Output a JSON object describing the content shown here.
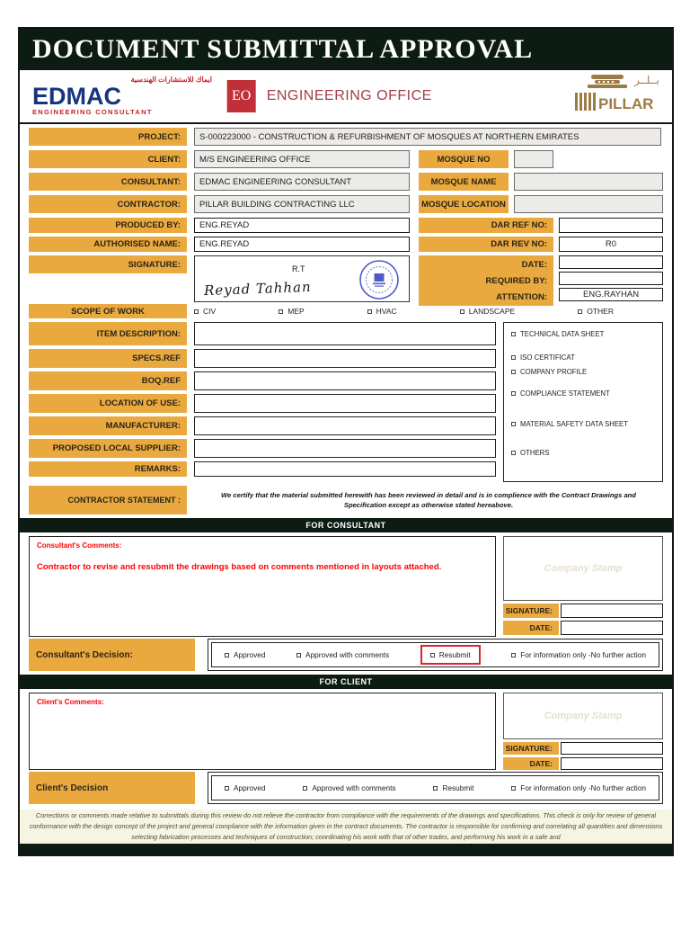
{
  "title": "DOCUMENT SUBMITTAL APPROVAL",
  "logos": {
    "edmac": {
      "arabic": "ايماك للاستشارات الهندسية",
      "name": "EDMAC",
      "subtitle": "ENGINEERING CONSULTANT"
    },
    "eo": {
      "abbr": "EO",
      "name": "ENGINEERING OFFICE"
    },
    "pillar": {
      "arabic": "بــلــر",
      "name": "PILLAR"
    }
  },
  "form": {
    "rows": {
      "project": {
        "label": "PROJECT:",
        "value": "S-000223000 - CONSTRUCTION & REFURBISHMENT OF MOSQUES AT NORTHERN EMIRATES"
      },
      "client": {
        "label": "CLIENT:",
        "value": "M/S ENGINEERING OFFICE"
      },
      "consultant": {
        "label": "CONSULTANT:",
        "value": "EDMAC ENGINEERING CONSULTANT"
      },
      "contractor": {
        "label": "CONTRACTOR:",
        "value": "PILLAR BUILDING CONTRACTING LLC"
      },
      "produced_by": {
        "label": "PRODUCED BY:",
        "value": "ENG.REYAD"
      },
      "authorised_name": {
        "label": "AUTHORISED NAME:",
        "value": "ENG.REYAD"
      },
      "signature": {
        "label": "SIGNATURE:",
        "script_name": "Reyad Tahhan",
        "initials": "R.T"
      },
      "mosque_no": {
        "label": "MOSQUE NO",
        "value": ""
      },
      "mosque_name": {
        "label": "MOSQUE NAME",
        "value": ""
      },
      "mosque_location": {
        "label": "MOSQUE LOCATION",
        "value": ""
      },
      "dar_ref_no": {
        "label": "DAR REF NO:",
        "value": ""
      },
      "dar_rev_no": {
        "label": "DAR REV NO:",
        "value": "R0"
      },
      "date": {
        "label": "DATE:",
        "value": ""
      },
      "required_by": {
        "label": "REQUIRED BY:",
        "value": ""
      },
      "attention": {
        "label": "ATTENTION:",
        "value": "ENG.RAYHAN"
      }
    },
    "scope_of_work": {
      "label": "SCOPE OF WORK",
      "options": [
        "CIV",
        "MEP",
        "HVAC",
        "LANDSCAPE",
        "OTHER"
      ]
    },
    "item_description_label": "ITEM DESCRIPTION:",
    "specs_ref_label": "SPECS.REF",
    "boq_ref_label": "BOQ.REF",
    "location_of_use_label": "LOCATION OF USE:",
    "manufacturer_label": "MANUFACTURER:",
    "proposed_local_supplier_label": "PROPOSED LOCAL SUPPLIER:",
    "remarks_label": "REMARKS:",
    "contractor_statement": {
      "label": "CONTRACTOR STATEMENT :",
      "text": "We certify that the material submitted herewith has been reviewed in detail and is in complience with the  Contract Drawings and Specification except as otherwise stated hereabove."
    },
    "attachments": [
      "TECHNICAL DATA SHEET",
      "ISO CERTIFICAT",
      "COMPANY PROFILE",
      "COMPLIANCE STATEMENT",
      "MATERIAL SAFETY DATA SHEET",
      "OTHERS"
    ]
  },
  "consultant_section": {
    "bar_title": "FOR CONSULTANT",
    "comments_label": "Consultant's Comments:",
    "comments_text": "Contractor to revise and resubmit the drawings based on comments mentioned in layouts attached.",
    "stamp_text": "Company Stamp",
    "signature_label": "SIGNATURE:",
    "date_label": "DATE:",
    "decision_label": "Consultant's Decision:",
    "options": [
      "Approved",
      "Approved with comments",
      "Resubmit",
      "For information only -No further action"
    ],
    "highlighted_option": "Resubmit"
  },
  "client_section": {
    "bar_title": "FOR CLIENT",
    "comments_label": "Client's Comments:",
    "comments_text": "",
    "stamp_text": "Company Stamp",
    "signature_label": "SIGNATURE:",
    "date_label": "DATE:",
    "decision_label": "Client's Decision",
    "options": [
      "Approved",
      "Approved with comments",
      "Resubmit",
      "For information only -No further action"
    ]
  },
  "footer_text": "Corrections or comments made relative to submittals during this review do not relieve the contractor from compliance with the requirements of the drawings and specifications.  This check is only for review of general conformance with the design concept of the project and general compliance with the information given in the contract documents.  The contractor is responsible for confirming and correlating all quantities and dimensions selecting fabrication processes and techniques of construction; coordinating his work with that of other trades, and performing his work in a safe and",
  "colors": {
    "gold": "#E9A93F",
    "header_bar": "#0D1C13",
    "highlight_red": "#D9232E",
    "comment_red": "#FF0000",
    "edmac_blue": "#16357F",
    "edmac_red": "#C32026",
    "eo_red": "#C13038",
    "pillar_gold": "#9C7B46",
    "stamp_blue": "#4E5BC8"
  }
}
